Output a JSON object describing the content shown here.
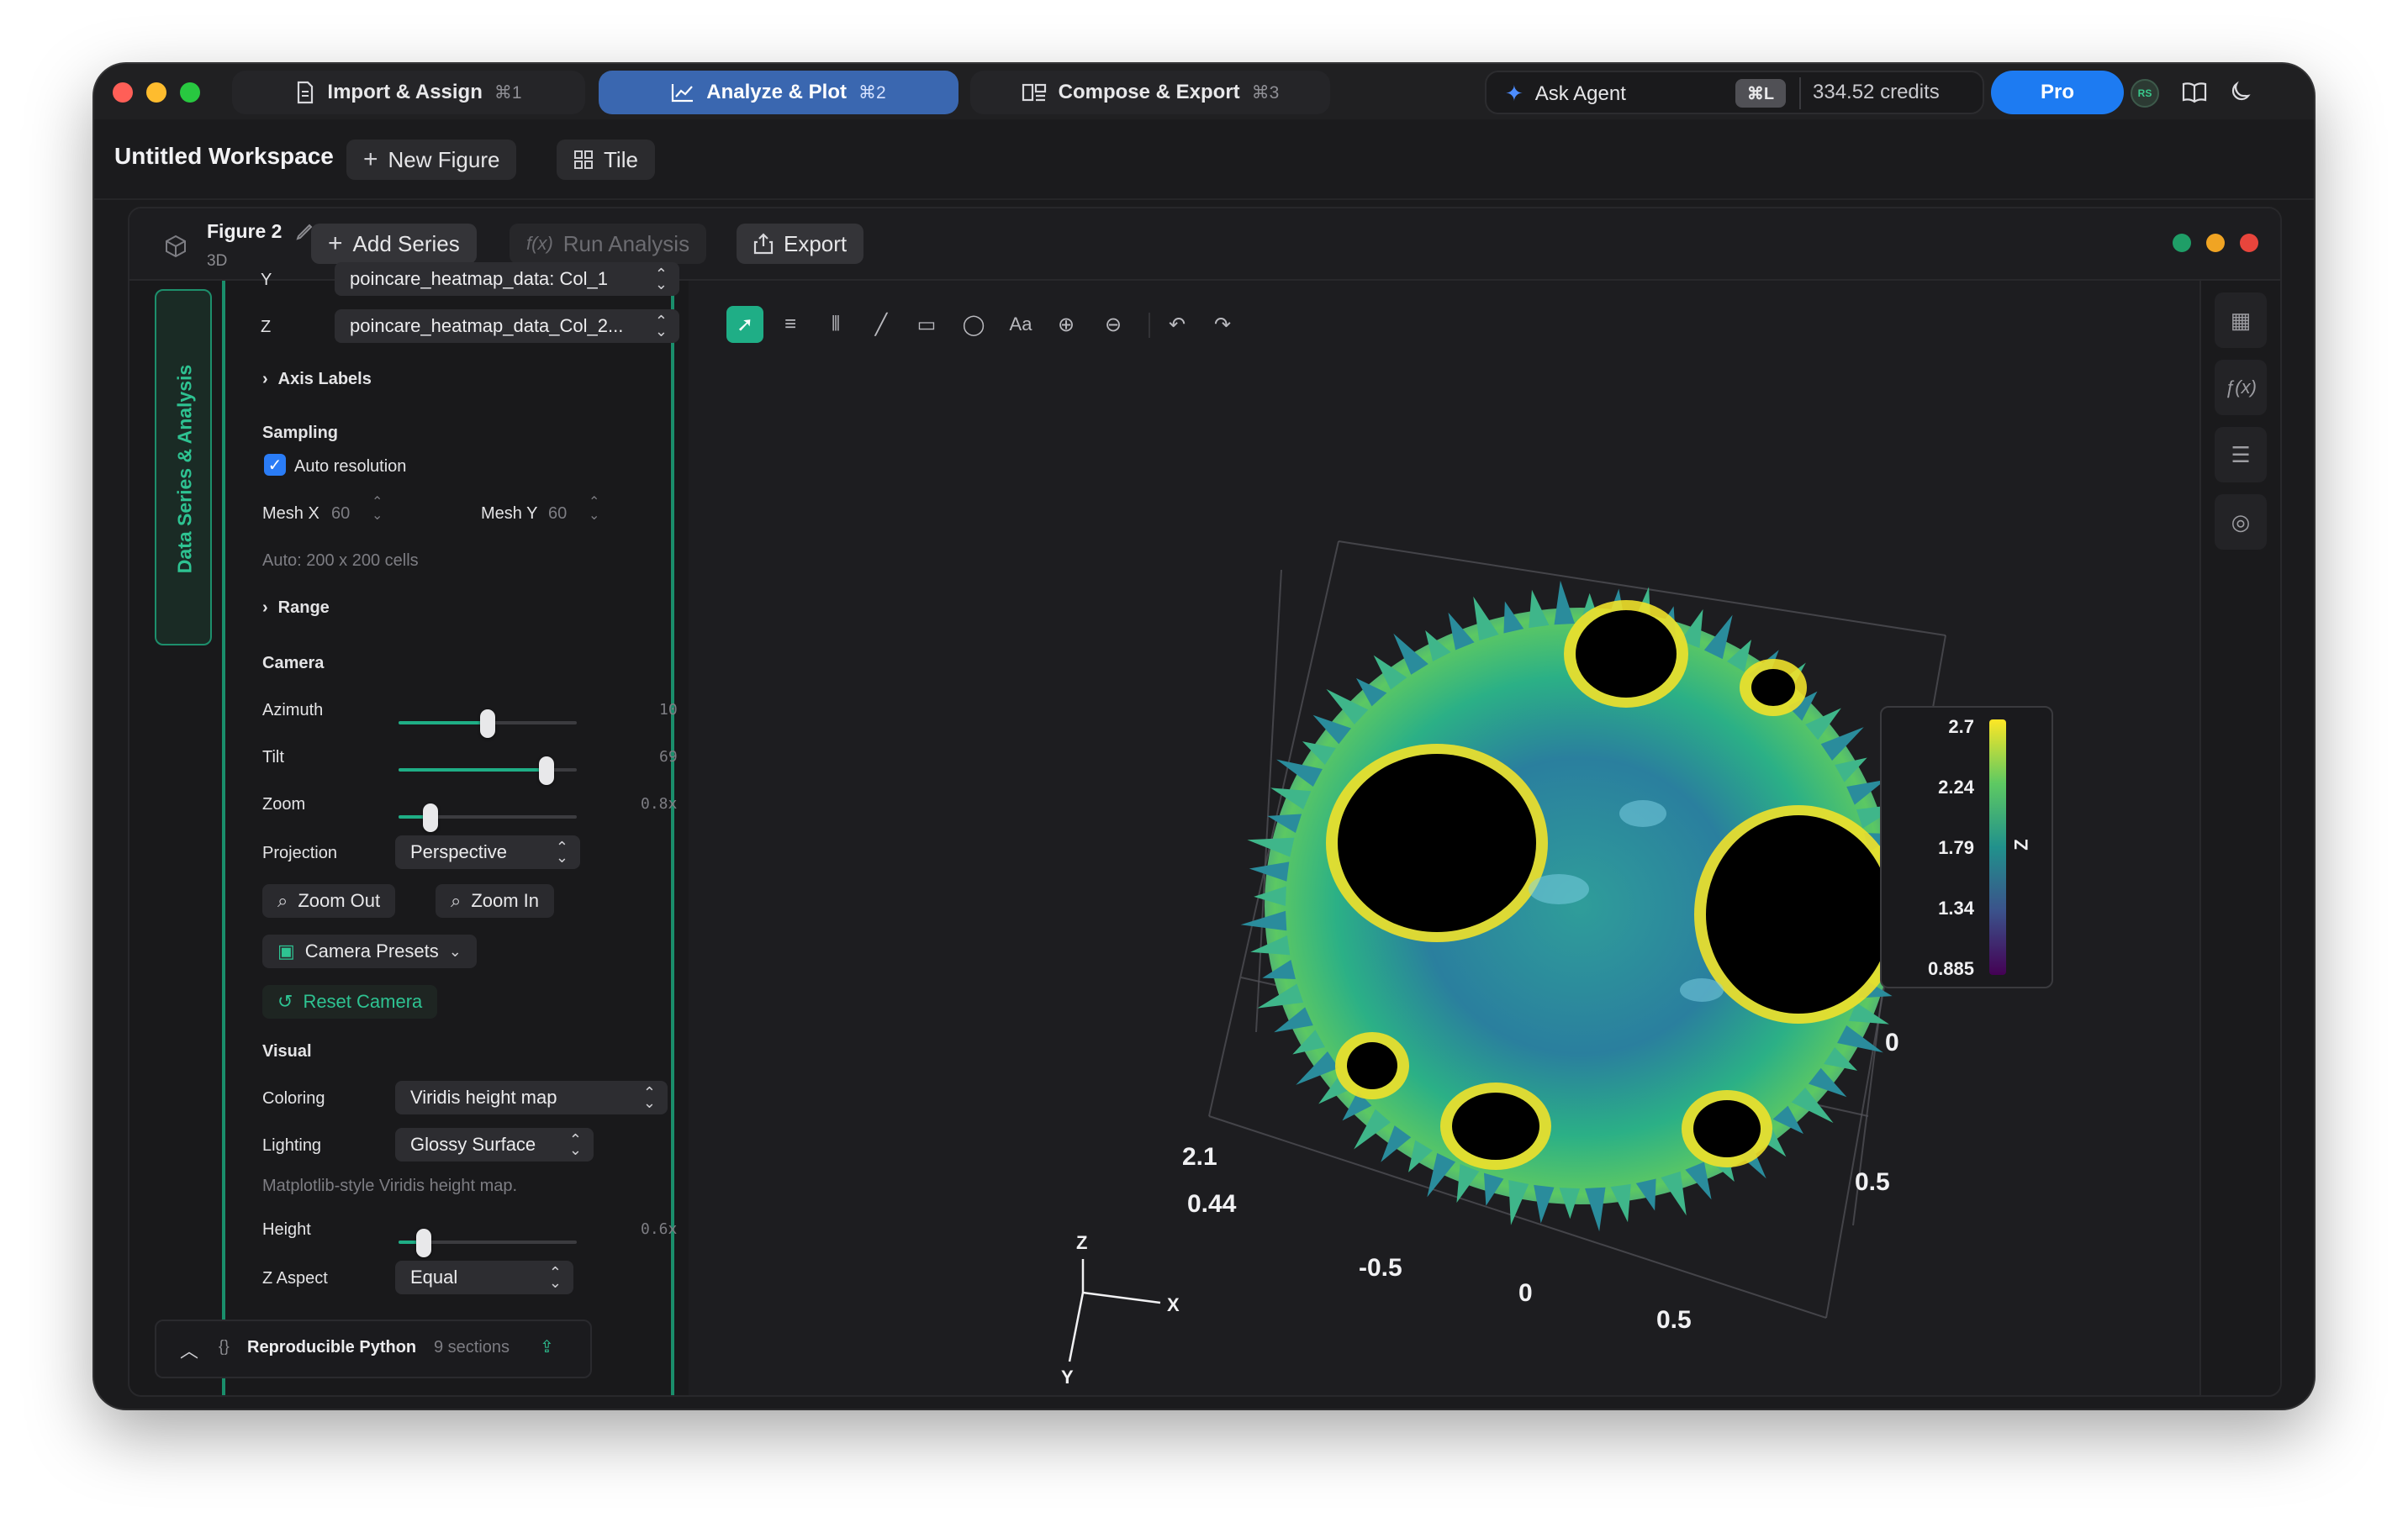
{
  "app": {
    "tabs": [
      {
        "label": "Import & Assign",
        "shortcut": "⌘1"
      },
      {
        "label": "Analyze & Plot",
        "shortcut": "⌘2"
      },
      {
        "label": "Compose & Export",
        "shortcut": "⌘3"
      }
    ],
    "ask_agent": "Ask Agent",
    "agent_shortcut": "⌘L",
    "credits": "334.52 credits",
    "pro_label": "Pro",
    "avatar_initials": "RS"
  },
  "workspace": {
    "title": "Untitled Workspace",
    "new_figure": "New Figure",
    "tile": "Tile"
  },
  "figure": {
    "name": "Figure 2",
    "kind": "3D",
    "add_series": "Add Series",
    "run_analysis": "Run Analysis",
    "run_analysis_fx": "f(x)",
    "export": "Export"
  },
  "sidebar": {
    "vertical_tab": "Data Series & Analysis",
    "top_row_axis": "Y",
    "top_row_value": "poincare_heatmap_data: Col_1",
    "z_axis_label": "Z",
    "z_value": "poincare_heatmap_data_Col_2...",
    "axis_labels": "Axis Labels",
    "sampling_title": "Sampling",
    "auto_resolution": "Auto resolution",
    "mesh_x_label": "Mesh X",
    "mesh_x_value": "60",
    "mesh_y_label": "Mesh Y",
    "mesh_y_value": "60",
    "auto_cells": "Auto: 200 x 200 cells",
    "range": "Range",
    "camera_title": "Camera",
    "azimuth_label": "Azimuth",
    "azimuth_value": "10",
    "azimuth_level": 0.5,
    "tilt_label": "Tilt",
    "tilt_value": "69",
    "tilt_level": 0.83,
    "zoom_label": "Zoom",
    "zoom_value": "0.8x",
    "zoom_level": 0.18,
    "projection_label": "Projection",
    "projection_value": "Perspective",
    "zoom_out": "Zoom Out",
    "zoom_in": "Zoom In",
    "camera_presets": "Camera Presets",
    "reset_camera": "Reset Camera",
    "visual_title": "Visual",
    "coloring_label": "Coloring",
    "coloring_value": "Viridis height map",
    "lighting_label": "Lighting",
    "lighting_value": "Glossy Surface",
    "lighting_note": "Matplotlib-style Viridis height map.",
    "height_label": "Height",
    "height_value": "0.6x",
    "height_level": 0.14,
    "zaspect_label": "Z Aspect",
    "zaspect_value": "Equal",
    "python_title": "Reproducible Python",
    "python_sections": "9 sections"
  },
  "chart_data": {
    "type": "surface3d",
    "title": "",
    "colormap": "viridis",
    "colorbar": {
      "label": "Z",
      "ticks": [
        "2.7",
        "2.24",
        "1.79",
        "1.34",
        "0.885"
      ],
      "range": [
        0.885,
        2.7
      ]
    },
    "x_ticks": [
      "-0.5",
      "0",
      "0.5"
    ],
    "y_ticks": [
      "-0.5",
      "0",
      "0.5"
    ],
    "z_ticks": [
      "2.1",
      "0.44"
    ],
    "axis_triad": [
      "Z",
      "X",
      "Y"
    ]
  }
}
